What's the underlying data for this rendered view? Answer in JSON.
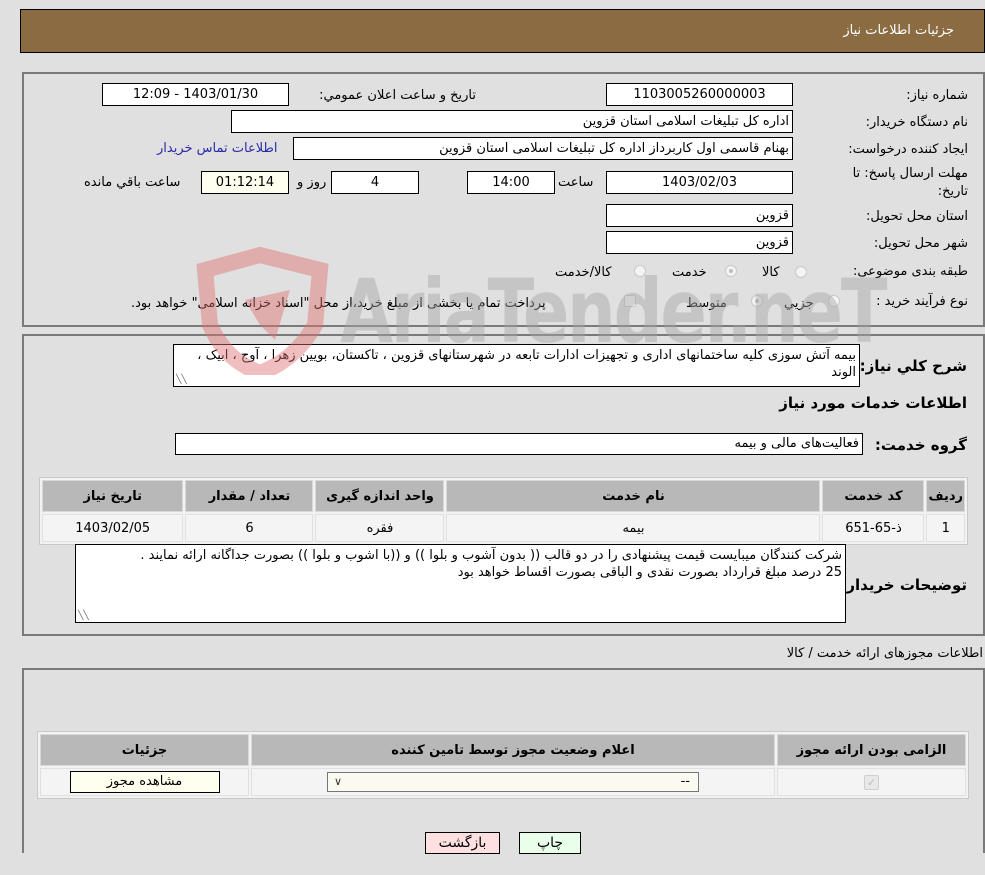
{
  "header": {
    "title": "جزئیات اطلاعات نیاز"
  },
  "form": {
    "need_number": {
      "label": "شماره نیاز:",
      "value": "1103005260000003"
    },
    "announce_datetime": {
      "label": "تاریخ و ساعت اعلان عمومي:",
      "value": "1403/01/30 - 12:09"
    },
    "buyer_org": {
      "label": "نام دستگاه خريدار:",
      "value": "اداره کل تبلیغات اسلامی استان قزوین"
    },
    "requester": {
      "label": "ايجاد کننده درخواست:",
      "value": "بهنام قاسمی اول کاربرداز اداره کل تبلیغات اسلامی استان قزوین"
    },
    "buyer_contact_link": "اطلاعات تماس خریدار",
    "deadline": {
      "label_line1": "مهلت ارسال پاسخ: تا",
      "label_line2": "تاریخ:",
      "date": "1403/02/03",
      "time_label": "ساعت",
      "time": "14:00",
      "days": "4",
      "days_label": "روز و",
      "remaining": "01:12:14",
      "remaining_label": "ساعت باقي مانده"
    },
    "delivery_province": {
      "label": "استان محل تحویل:",
      "value": "قزوین"
    },
    "delivery_city": {
      "label": "شهر محل تحویل:",
      "value": "قزوین"
    },
    "category": {
      "label": "طبقه بندی موضوعی:",
      "options": [
        {
          "label": "کالا",
          "checked": false
        },
        {
          "label": "خدمت",
          "checked": true
        },
        {
          "label": "کالا/خدمت",
          "checked": false
        }
      ]
    },
    "purchase_process": {
      "label": "نوع فرآيند خريد :",
      "options": [
        {
          "label": "جزيي",
          "checked": false
        },
        {
          "label": "متوسط",
          "checked": true
        }
      ],
      "treasury_checkbox_label": "پرداخت تمام یا بخشی از مبلغ خرید،از محل \"اسناد خزانه اسلامی\" خواهد بود.",
      "treasury_checked": false
    }
  },
  "description": {
    "label": "شرح کلي نياز:",
    "text": "بیمه آتش سوزی کلیه ساختمانهای اداری و تجهیزات ادارات تابعه در شهرستانهای قزوین ، تاکستان، بویین زهرا ، آوج ، ابیک ، الوند"
  },
  "services": {
    "section_title": "اطلاعات خدمات مورد نياز",
    "group_label": "گروه خدمت:",
    "group_value": "فعالیت‌های مالی و بیمه",
    "columns": [
      "رديف",
      "کد خدمت",
      "نام خدمت",
      "واحد اندازه گيری",
      "تعداد / مقدار",
      "تاريخ نياز"
    ],
    "rows": [
      {
        "row": "1",
        "code": "ذ-65-651",
        "name": "بیمه",
        "unit": "فقره",
        "qty": "6",
        "date": "1403/02/05"
      }
    ]
  },
  "buyer_notes": {
    "label": "توضيحات خريدار:",
    "lines": [
      "شرکت کنندگان میبایست قیمت پیشنهادی را در دو قالب (( بدون آشوب و بلوا )) و ((با اشوب و بلوا )) بصورت جداگانه ارائه نمایند .",
      "25 درصد مبلغ قرارداد بصورت نقدی و الباقی بصورت اقساط خواهد بود"
    ]
  },
  "permits": {
    "section_title": "اطلاعات مجوزهای ارائه خدمت / کالا",
    "columns": [
      "الزامی بودن ارائه مجوز",
      "اعلام وضعیت مجوز توسط تامین کننده",
      "جزئیات"
    ],
    "rows": [
      {
        "required": true,
        "status_value": "--",
        "details_button": "مشاهده مجوز"
      }
    ]
  },
  "footer": {
    "print_button": "چاپ",
    "back_button": "بازگشت"
  },
  "colors": {
    "header_bg": "#8b6c42",
    "back_button_bg": "#ffe0e0",
    "print_button_bg": "#eaffea",
    "link": "#2a2aa8"
  },
  "watermark": {
    "text": "AriaTender.neT"
  }
}
